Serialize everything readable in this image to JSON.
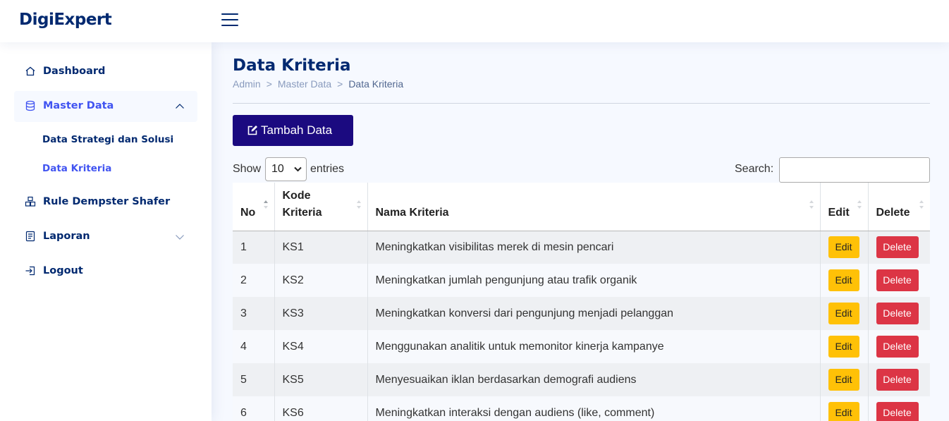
{
  "header": {
    "logo": "DigiExpert"
  },
  "sidebar": {
    "items": [
      {
        "label": "Dashboard",
        "icon": "house-icon"
      },
      {
        "label": "Master Data",
        "icon": "database-icon",
        "expanded": true,
        "children": [
          {
            "label": "Data Strategi dan Solusi"
          },
          {
            "label": "Data Kriteria",
            "active": true
          }
        ]
      },
      {
        "label": "Rule Dempster Shafer",
        "icon": "boxes-icon"
      },
      {
        "label": "Laporan",
        "icon": "report-icon"
      },
      {
        "label": "Logout",
        "icon": "logout-icon"
      }
    ]
  },
  "page": {
    "title": "Data Kriteria",
    "breadcrumb": [
      "Admin",
      "Master Data",
      "Data Kriteria"
    ],
    "add_button": "Tambah Data",
    "show_label": "Show",
    "entries_value": "10",
    "entries_label": "entries",
    "search_label": "Search:",
    "search_value": ""
  },
  "table": {
    "headers": {
      "no": "No",
      "kode_line1": "Kode",
      "kode_line2": "Kriteria",
      "nama": "Nama Kriteria",
      "edit": "Edit",
      "delete": "Delete"
    },
    "edit_label": "Edit",
    "delete_label": "Delete",
    "rows": [
      {
        "no": "1",
        "kode": "KS1",
        "nama": "Meningkatkan visibilitas merek di mesin pencari"
      },
      {
        "no": "2",
        "kode": "KS2",
        "nama": "Meningkatkan jumlah pengunjung atau trafik organik"
      },
      {
        "no": "3",
        "kode": "KS3",
        "nama": "Meningkatkan konversi dari pengunjung menjadi pelanggan"
      },
      {
        "no": "4",
        "kode": "KS4",
        "nama": "Menggunakan analitik untuk memonitor kinerja kampanye"
      },
      {
        "no": "5",
        "kode": "KS5",
        "nama": "Menyesuaikan iklan berdasarkan demografi audiens"
      },
      {
        "no": "6",
        "kode": "KS6",
        "nama": "Meningkatkan interaksi dengan audiens (like, comment)"
      }
    ]
  },
  "colors": {
    "brand": "#012970",
    "accent": "#4154f1",
    "primary_button": "#1b0a80",
    "edit": "#ffc107",
    "delete": "#dc3545"
  }
}
